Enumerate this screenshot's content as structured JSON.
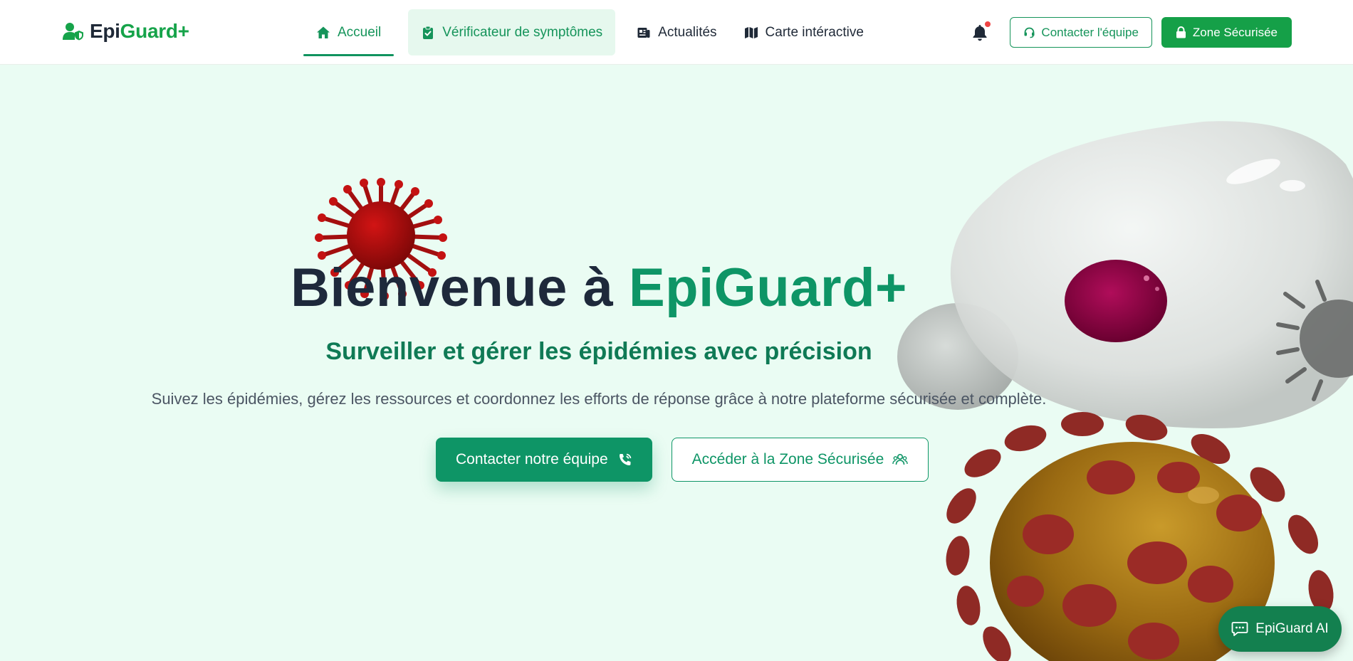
{
  "brand": {
    "name_part1": "Epi",
    "name_part2": "Guard+"
  },
  "nav": {
    "items": [
      {
        "label": "Accueil",
        "icon": "home-icon",
        "state": "active"
      },
      {
        "label": "Vérificateur de symptômes",
        "icon": "clipboard-check-icon",
        "state": "highlighted"
      },
      {
        "label": "Actualités",
        "icon": "newspaper-icon"
      },
      {
        "label": "Carte intéractive",
        "icon": "map-icon"
      }
    ]
  },
  "header": {
    "notification_icon": "bell-icon",
    "contact_label": "Contacter l'équipe",
    "secure_label": "Zone Sécurisée"
  },
  "hero": {
    "title_part1": "Bienvenue à ",
    "title_part2": "EpiGuard+",
    "subtitle": "Surveiller et gérer les épidémies avec précision",
    "description": "Suivez les épidémies, gérez les ressources et coordonnez les efforts de réponse grâce à notre plateforme sécurisée et complète.",
    "cta_primary": "Contacter notre équipe",
    "cta_secondary": "Accéder à la Zone Sécurisée"
  },
  "chat": {
    "label": "EpiGuard AI"
  },
  "colors": {
    "brand_green": "#16a34a",
    "primary": "#0e9566",
    "hero_background": "#eafcf3",
    "text_dark": "#1e293b",
    "notification_dot": "#ef4444"
  }
}
